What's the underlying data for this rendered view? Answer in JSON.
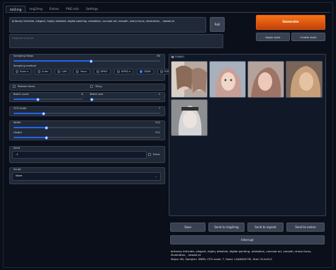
{
  "tabs": [
    "txt2img",
    "img2img",
    "Extras",
    "PNG Info",
    "Settings"
  ],
  "prompt": {
    "value": "britoney intricate, elegant, highly detailed, digital painting, artstation, concept art, smooth, sharp focus, illustration, , kawaii pt",
    "negative_placeholder": "Negative prompt"
  },
  "buttons": {
    "roll": "Roll",
    "generate": "Generate",
    "apply_style": "Apply style",
    "create_style": "Create style",
    "save": "Save",
    "send_img2img": "Send to img2img",
    "send_inpaint": "Send to inpaint",
    "send_extras": "Send to extras",
    "interrupt": "Interrupt"
  },
  "sampling_steps": {
    "label": "Sampling Steps",
    "value": "80",
    "fraction": 0.53
  },
  "sampling_method": {
    "label": "Sampling method",
    "options": [
      "Euler a",
      "Euler",
      "LMS",
      "Heun",
      "DPM2",
      "DPM2 a",
      "DDIM",
      "PLMS"
    ],
    "selected": "DDIM"
  },
  "restore_faces": "Restore faces",
  "tiling": "Tiling",
  "batch_count": {
    "label": "Batch count",
    "value": "6",
    "fraction": 0.35
  },
  "batch_size": {
    "label": "Batch size",
    "value": "1",
    "fraction": 0.02
  },
  "cfg_scale": {
    "label": "CFG Scale",
    "value": "7",
    "fraction": 0.2
  },
  "width": {
    "label": "Width",
    "value": "512",
    "fraction": 0.22
  },
  "height": {
    "label": "Height",
    "value": "512",
    "fraction": 0.22
  },
  "seed": {
    "label": "Seed",
    "value": "-1",
    "extra": "Extra"
  },
  "script": {
    "label": "Script",
    "value": "None"
  },
  "output_label": "Output",
  "info": {
    "line1": "britoney intricate, elegant, highly detailed, digital painting, artstation, concept art, smooth, sharp focus, illustration, , kawaii pt",
    "line2": "Steps: 80, Sampler: DDIM, CFG scale: 7, Seed: 1448400735, Size: 512x512"
  },
  "colors": {
    "accent": "#f97316",
    "slider": "#2563eb",
    "background": "#0b0f19"
  }
}
